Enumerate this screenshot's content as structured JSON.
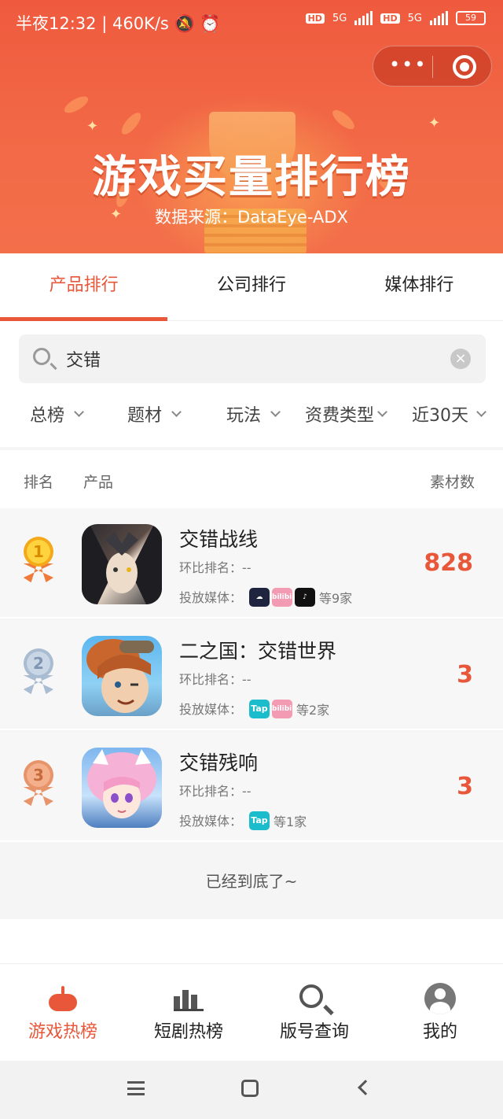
{
  "status_bar": {
    "time": "半夜12:32",
    "speed": "460K/s",
    "battery": "59",
    "network": "5G",
    "hd_label": "HD"
  },
  "banner": {
    "title": "游戏买量排行榜",
    "subtitle": "数据来源：DataEye-ADX"
  },
  "tabs": [
    {
      "label": "产品排行",
      "active": true
    },
    {
      "label": "公司排行",
      "active": false
    },
    {
      "label": "媒体排行",
      "active": false
    }
  ],
  "search": {
    "value": "交错",
    "clear_icon": "x-circle-icon"
  },
  "filters": [
    {
      "label": "总榜"
    },
    {
      "label": "题材"
    },
    {
      "label": "玩法"
    },
    {
      "label": "资费类型"
    },
    {
      "label": "近30天"
    }
  ],
  "table": {
    "headers": {
      "rank": "排名",
      "product": "产品",
      "count": "素材数"
    },
    "rows": [
      {
        "rank": "1",
        "name": "交错战线",
        "change_label": "环比排名：",
        "change_value": "--",
        "media_label": "投放媒体：",
        "media": [
          "cloud-app-icon",
          "bilibili-icon",
          "tiktok-icon"
        ],
        "media_more": "等9家",
        "count": "828"
      },
      {
        "rank": "2",
        "name": "二之国：交错世界",
        "change_label": "环比排名：",
        "change_value": "--",
        "media_label": "投放媒体：",
        "media": [
          "taptap-icon",
          "bilibili-icon"
        ],
        "media_more": "等2家",
        "count": "3"
      },
      {
        "rank": "3",
        "name": "交错残响",
        "change_label": "环比排名：",
        "change_value": "--",
        "media_label": "投放媒体：",
        "media": [
          "taptap-icon"
        ],
        "media_more": "等1家",
        "count": "3"
      }
    ]
  },
  "end_note": "已经到底了~",
  "bottom_nav": [
    {
      "label": "游戏热榜",
      "icon": "gamepad-icon",
      "active": true
    },
    {
      "label": "短剧热榜",
      "icon": "bar-chart-icon",
      "active": false
    },
    {
      "label": "版号查询",
      "icon": "search-icon",
      "active": false
    },
    {
      "label": "我的",
      "icon": "user-avatar-icon",
      "active": false
    }
  ],
  "media_icon_text": {
    "bili": "bilibili",
    "tap": "Tap"
  },
  "colors": {
    "accent": "#e8573a",
    "banner": "#ef5a3e"
  }
}
